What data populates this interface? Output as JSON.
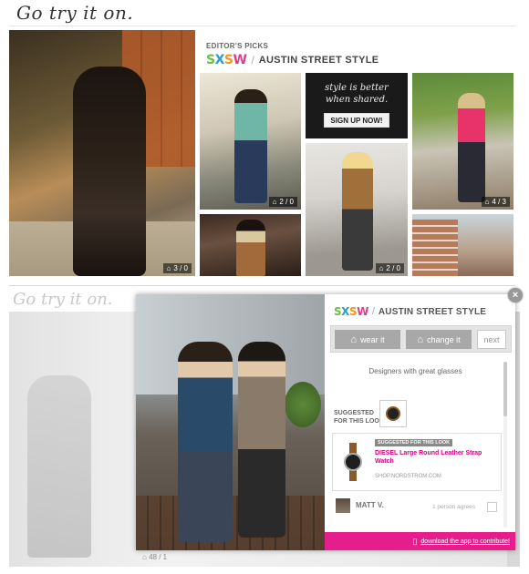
{
  "header": {
    "logo_text": "Go try it on."
  },
  "picks": {
    "label": "EDITOR'S PICKS",
    "brand": [
      "S",
      "X",
      "S",
      "W"
    ],
    "slash": "/",
    "title": "AUSTIN STREET STYLE"
  },
  "tiles": [
    {
      "stats": "3 / 0"
    },
    {
      "stats": "2 / 0"
    },
    {
      "stats": "4 / 3"
    },
    {
      "stats": "2 / 0"
    }
  ],
  "promo": {
    "script_line1": "style is better",
    "script_line2": "when shared.",
    "signup_label": "SIGN UP NOW!"
  },
  "second_section": {
    "logo_text": "Go try it on.",
    "stats": "48 / 1"
  },
  "modal": {
    "close_label": "×",
    "brand": [
      "S",
      "X",
      "S",
      "W"
    ],
    "slash": "/",
    "title": "AUSTIN STREET STYLE",
    "actions": {
      "wear_label": "wear it",
      "change_label": "change it",
      "next_label": "next"
    },
    "caption": "Designers with great glasses",
    "suggested_label_line1": "SUGGESTED",
    "suggested_label_line2": "FOR THIS LOOK",
    "product": {
      "badge": "SUGGESTED FOR THIS LOOK",
      "name": "DIESEL Large Round Leather Strap Watch",
      "shop": "SHOP.NORDSTROM.COM"
    },
    "comment": {
      "user": "MATT V.",
      "agree_text": "1 person agrees"
    },
    "footer": {
      "download_label": "download the app to contribute!"
    }
  },
  "colors": {
    "accent_pink": "#e51e8c",
    "sxsw_green": "#6fbe44",
    "sxsw_blue": "#2a9bd7",
    "sxsw_orange": "#f7941d",
    "sxsw_magenta": "#e03c8a"
  },
  "icons": [
    "hanger-icon",
    "comment-icon",
    "close-icon",
    "phone-icon",
    "next-arrow-icon"
  ]
}
